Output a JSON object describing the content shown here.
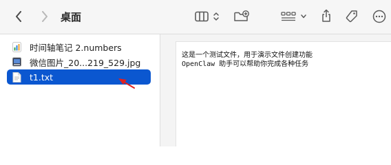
{
  "window": {
    "title": "桌面"
  },
  "toolbar": {
    "back_icon": "chevron-left-icon",
    "forward_icon": "chevron-right-icon",
    "view_icon": "column-view-icon",
    "sort_icon": "up-down-chevron-icon",
    "new_folder_icon": "new-folder-icon",
    "group_icon": "group-by-grid-icon",
    "group_chevron_icon": "chevron-down-icon",
    "share_icon": "share-icon",
    "tag_icon": "tag-icon",
    "more_icon": "ellipsis-circle-icon"
  },
  "files": [
    {
      "name": "时间轴笔记 2.numbers",
      "icon": "numbers-file-icon",
      "selected": false
    },
    {
      "name": "微信图片_20...219_529.jpg",
      "icon": "jpg-image-icon",
      "selected": false
    },
    {
      "name": "t1.txt",
      "icon": "text-file-icon",
      "selected": true
    }
  ],
  "preview": {
    "lines": [
      "这是一个测试文件，用于演示文件创建功能",
      "OpenClaw 助手可以帮助你完成各种任务"
    ]
  },
  "annotation": {
    "type": "red-arrow",
    "color": "#e0211f"
  },
  "colors": {
    "selection": "#0b57d0",
    "toolbar_bg": "#f6f6f6",
    "preview_bg": "#f4f4f4"
  }
}
